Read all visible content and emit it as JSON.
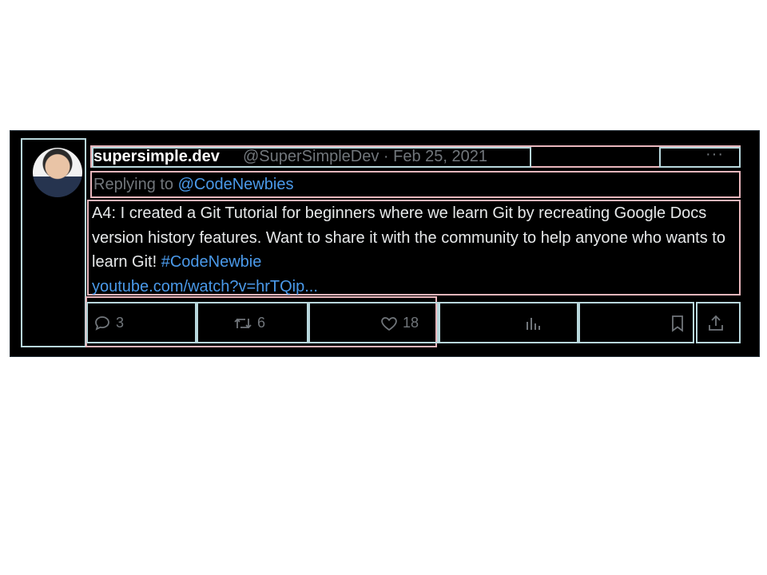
{
  "tweet": {
    "display_name": "supersimple.dev",
    "handle_date": "@SuperSimpleDev · Feb 25, 2021",
    "more": "···",
    "reply_prefix": "Replying to",
    "reply_mention": "@CodeNewbies",
    "body": "A4: I created a Git Tutorial for beginners where we learn Git by recreating Google Docs version history features. Want to share it with the community to help anyone who wants to learn Git!",
    "hashtag": "#CodeNewbie",
    "link": "youtube.com/watch?v=hrTQip..."
  },
  "actions": {
    "reply_count": "3",
    "retweet_count": "6",
    "like_count": "18"
  },
  "icons": [
    "comment-icon",
    "retweet-icon",
    "heart-icon",
    "analytics-icon",
    "bookmark-icon",
    "share-icon"
  ],
  "colors": {
    "background": "#000000",
    "text": "#e7e9ea",
    "muted": "#71767b",
    "link": "#4a99e9"
  }
}
